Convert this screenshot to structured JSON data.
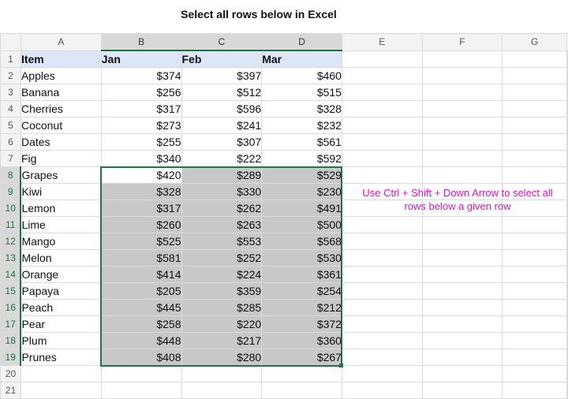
{
  "title": "Select all rows below in Excel",
  "columns": [
    "A",
    "B",
    "C",
    "D",
    "E",
    "F",
    "G"
  ],
  "header": {
    "row": "1",
    "cells": [
      "Item",
      "Jan",
      "Feb",
      "Mar"
    ]
  },
  "rows": [
    {
      "row": "2",
      "item": "Apples",
      "jan": "$374",
      "feb": "$397",
      "mar": "$460"
    },
    {
      "row": "3",
      "item": "Banana",
      "jan": "$256",
      "feb": "$512",
      "mar": "$515"
    },
    {
      "row": "4",
      "item": "Cherries",
      "jan": "$317",
      "feb": "$596",
      "mar": "$328"
    },
    {
      "row": "5",
      "item": "Coconut",
      "jan": "$273",
      "feb": "$241",
      "mar": "$232"
    },
    {
      "row": "6",
      "item": "Dates",
      "jan": "$255",
      "feb": "$307",
      "mar": "$561"
    },
    {
      "row": "7",
      "item": "Fig",
      "jan": "$340",
      "feb": "$222",
      "mar": "$592"
    },
    {
      "row": "8",
      "item": "Grapes",
      "jan": "$420",
      "feb": "$289",
      "mar": "$529"
    },
    {
      "row": "9",
      "item": "Kiwi",
      "jan": "$328",
      "feb": "$330",
      "mar": "$230"
    },
    {
      "row": "10",
      "item": "Lemon",
      "jan": "$317",
      "feb": "$262",
      "mar": "$491"
    },
    {
      "row": "11",
      "item": "Lime",
      "jan": "$260",
      "feb": "$263",
      "mar": "$500"
    },
    {
      "row": "12",
      "item": "Mango",
      "jan": "$525",
      "feb": "$553",
      "mar": "$568"
    },
    {
      "row": "13",
      "item": "Melon",
      "jan": "$581",
      "feb": "$252",
      "mar": "$530"
    },
    {
      "row": "14",
      "item": "Orange",
      "jan": "$414",
      "feb": "$224",
      "mar": "$361"
    },
    {
      "row": "15",
      "item": "Papaya",
      "jan": "$205",
      "feb": "$359",
      "mar": "$254"
    },
    {
      "row": "16",
      "item": "Peach",
      "jan": "$445",
      "feb": "$285",
      "mar": "$212"
    },
    {
      "row": "17",
      "item": "Pear",
      "jan": "$258",
      "feb": "$220",
      "mar": "$372"
    },
    {
      "row": "18",
      "item": "Plum",
      "jan": "$448",
      "feb": "$217",
      "mar": "$360"
    },
    {
      "row": "19",
      "item": "Prunes",
      "jan": "$408",
      "feb": "$280",
      "mar": "$267"
    }
  ],
  "empty_rows": [
    "20",
    "21"
  ],
  "selection": {
    "first_row": "8",
    "last_row": "19",
    "active_cell": "B8",
    "columns": [
      "B",
      "C",
      "D"
    ]
  },
  "note": "Use Ctrl + Shift + Down Arrow to select all rows below a given row",
  "colors": {
    "selection_border": "#217346",
    "note": "#e012c8",
    "selected_fill": "#c8c8c8",
    "header_fill": "#dde6f6"
  }
}
